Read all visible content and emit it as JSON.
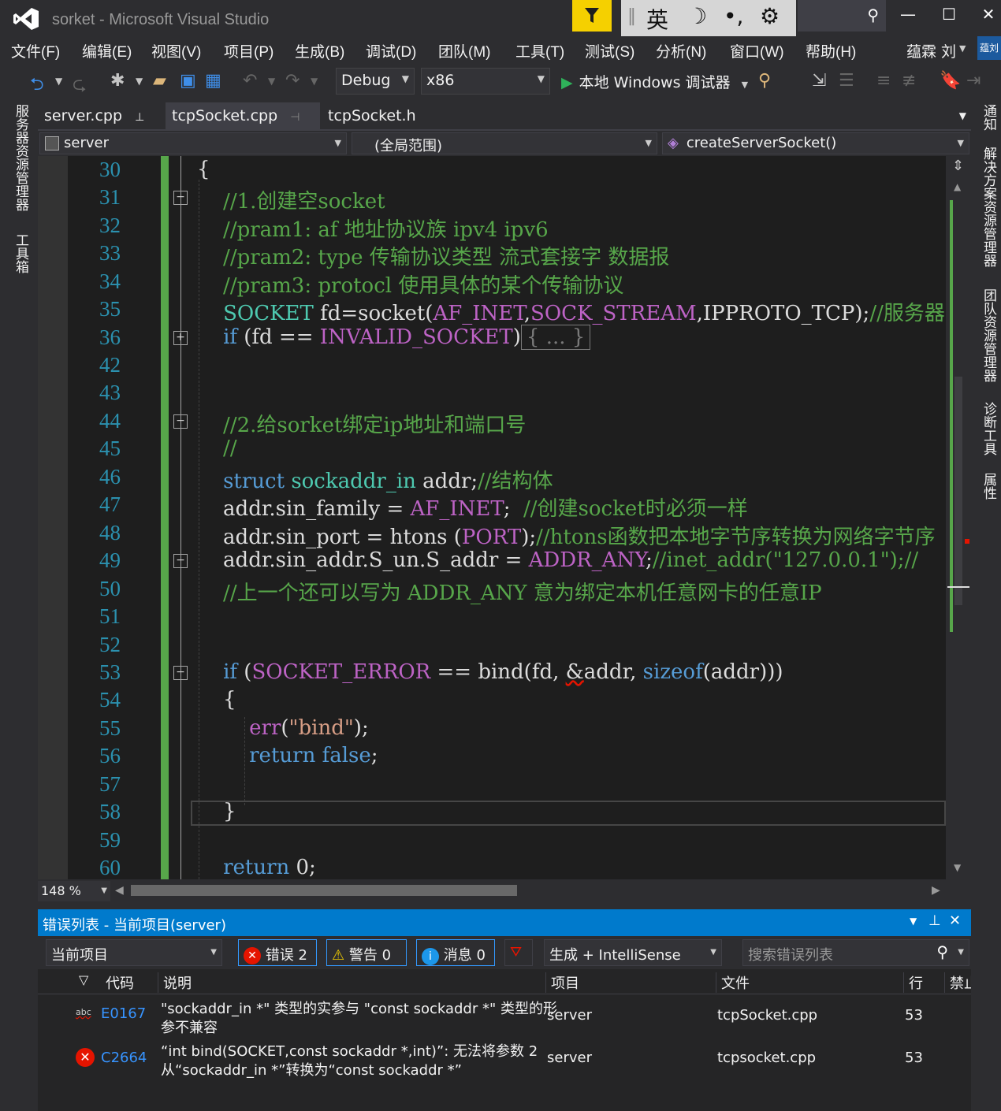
{
  "window": {
    "title": "sorket - Microsoft Visual Studio",
    "ime": {
      "lang": "英",
      "moon": "☽",
      "punct": "•,",
      "gear": "⚙"
    }
  },
  "menu": [
    "文件(F)",
    "编辑(E)",
    "视图(V)",
    "项目(P)",
    "生成(B)",
    "调试(D)",
    "团队(M)",
    "工具(T)",
    "测试(S)",
    "分析(N)",
    "窗口(W)",
    "帮助(H)"
  ],
  "user": {
    "name": "蕴霖 刘",
    "badge": "蕴刘"
  },
  "toolbar": {
    "config": "Debug",
    "platform": "x86",
    "run_label": "本地 Windows 调试器"
  },
  "left_panels": [
    "服务器资源管理器",
    "工具箱"
  ],
  "right_panels": [
    "通知",
    "解决方案资源管理器",
    "团队资源管理器",
    "诊断工具",
    "属性"
  ],
  "tabs": [
    {
      "label": "server.cpp",
      "pin": "🖈"
    },
    {
      "label": "tcpSocket.cpp",
      "pin": "⊣",
      "close": "✕"
    },
    {
      "label": "tcpSocket.h"
    }
  ],
  "nav": {
    "project": "server",
    "scope": "(全局范围)",
    "member": "createServerSocket()"
  },
  "code": {
    "line_numbers": [
      "30",
      "31",
      "32",
      "33",
      "34",
      "35",
      "36",
      "42",
      "43",
      "44",
      "45",
      "46",
      "47",
      "48",
      "49",
      "50",
      "51",
      "52",
      "53",
      "54",
      "55",
      "56",
      "57",
      "58",
      "59",
      "60"
    ]
  },
  "zoom": "148 %",
  "error_list": {
    "title": "错误列表 - 当前项目(server)",
    "scope": "当前项目",
    "errors_btn": "错误 2",
    "warnings_btn": "警告 0",
    "messages_btn": "消息 0",
    "source": "生成 + IntelliSense",
    "search_placeholder": "搜索错误列表",
    "columns": [
      "代码",
      "说明",
      "项目",
      "文件",
      "行",
      "禁止"
    ],
    "rows": [
      {
        "code": "E0167",
        "desc1": "\"sockaddr_in *\" 类型的实参与 \"const sockaddr *\" 类型的形",
        "desc2": "参不兼容",
        "project": "server",
        "file": "tcpSocket.cpp",
        "line": "53"
      },
      {
        "code": "C2664",
        "desc1": "“int bind(SOCKET,const sockaddr *,int)”: 无法将参数 2",
        "desc2": "从“sockaddr_in *”转换为“const sockaddr *”",
        "project": "server",
        "file": "tcpsocket.cpp",
        "line": "53"
      }
    ]
  }
}
